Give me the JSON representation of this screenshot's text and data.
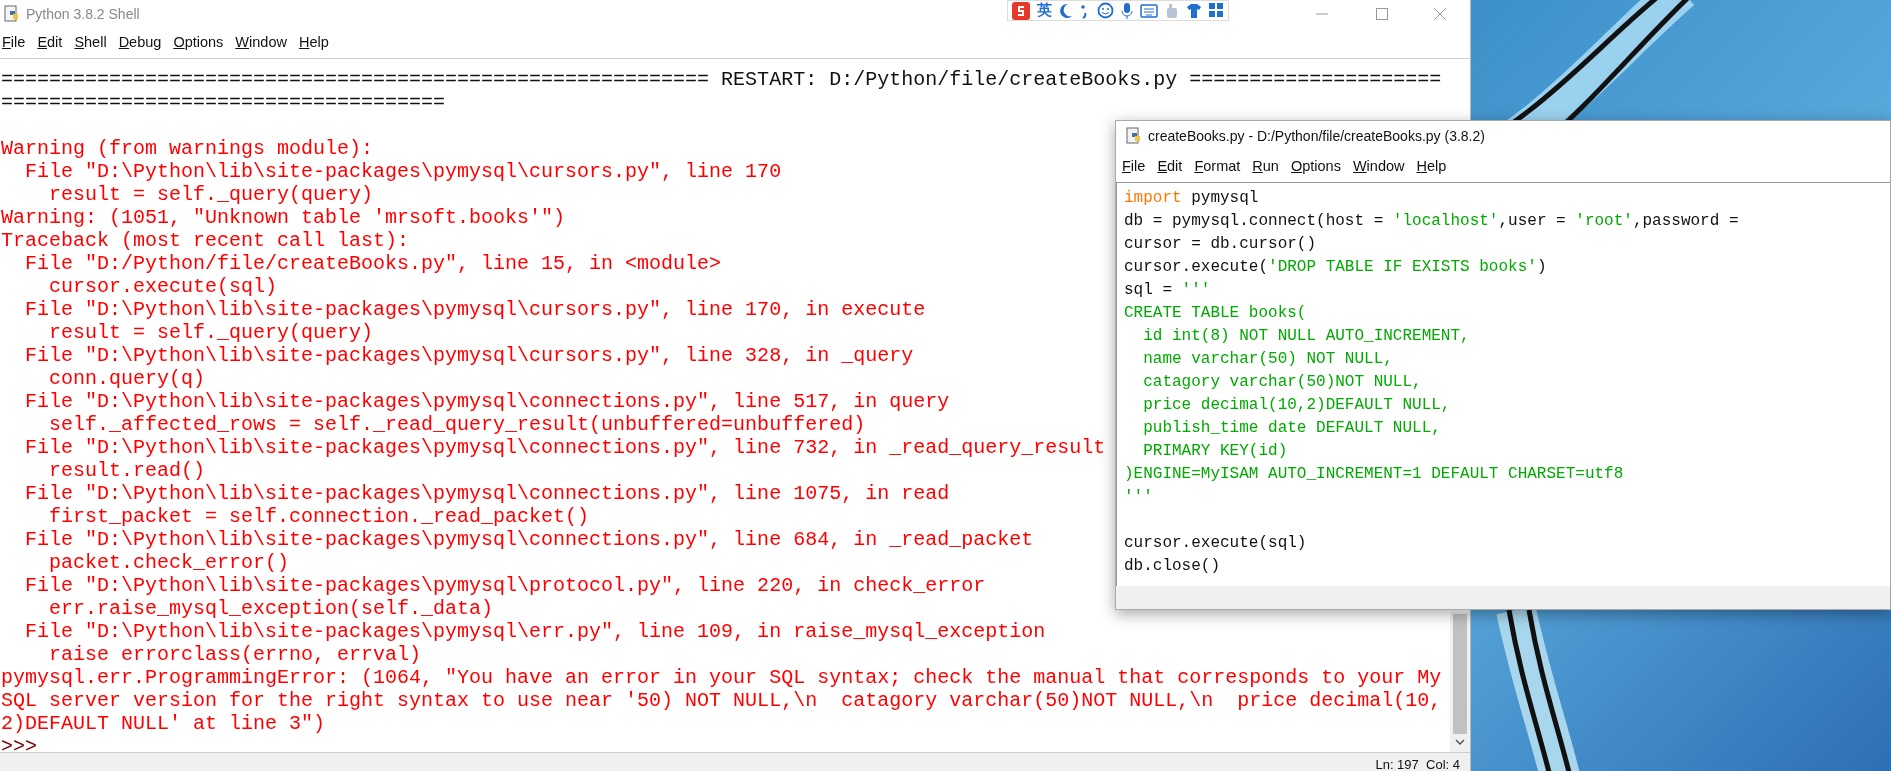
{
  "ime_toolbar": {
    "language": "英"
  },
  "shell": {
    "title": "Python 3.8.2 Shell",
    "menu": [
      "File",
      "Edit",
      "Shell",
      "Debug",
      "Options",
      "Window",
      "Help"
    ],
    "lines": [
      {
        "kind": "restart",
        "text": "=========================================================== RESTART: D:/Python/file/createBooks.py ====================="
      },
      {
        "kind": "restart",
        "text": "====================================="
      },
      {
        "kind": "blank"
      },
      {
        "kind": "error",
        "text": "Warning (from warnings module):"
      },
      {
        "kind": "error",
        "text": "  File \"D:\\Python\\lib\\site-packages\\pymysql\\cursors.py\", line 170"
      },
      {
        "kind": "error",
        "text": "    result = self._query(query)"
      },
      {
        "kind": "error",
        "text": "Warning: (1051, \"Unknown table 'mrsoft.books'\")"
      },
      {
        "kind": "error",
        "text": "Traceback (most recent call last):"
      },
      {
        "kind": "error",
        "text": "  File \"D:/Python/file/createBooks.py\", line 15, in <module>"
      },
      {
        "kind": "error",
        "text": "    cursor.execute(sql)"
      },
      {
        "kind": "error",
        "text": "  File \"D:\\Python\\lib\\site-packages\\pymysql\\cursors.py\", line 170, in execute"
      },
      {
        "kind": "error",
        "text": "    result = self._query(query)"
      },
      {
        "kind": "error",
        "text": "  File \"D:\\Python\\lib\\site-packages\\pymysql\\cursors.py\", line 328, in _query"
      },
      {
        "kind": "error",
        "text": "    conn.query(q)"
      },
      {
        "kind": "error",
        "text": "  File \"D:\\Python\\lib\\site-packages\\pymysql\\connections.py\", line 517, in query"
      },
      {
        "kind": "error",
        "text": "    self._affected_rows = self._read_query_result(unbuffered=unbuffered)"
      },
      {
        "kind": "error",
        "text": "  File \"D:\\Python\\lib\\site-packages\\pymysql\\connections.py\", line 732, in _read_query_result"
      },
      {
        "kind": "error",
        "text": "    result.read()"
      },
      {
        "kind": "error",
        "text": "  File \"D:\\Python\\lib\\site-packages\\pymysql\\connections.py\", line 1075, in read"
      },
      {
        "kind": "error",
        "text": "    first_packet = self.connection._read_packet()"
      },
      {
        "kind": "error",
        "text": "  File \"D:\\Python\\lib\\site-packages\\pymysql\\connections.py\", line 684, in _read_packet"
      },
      {
        "kind": "error",
        "text": "    packet.check_error()"
      },
      {
        "kind": "error",
        "text": "  File \"D:\\Python\\lib\\site-packages\\pymysql\\protocol.py\", line 220, in check_error"
      },
      {
        "kind": "error",
        "text": "    err.raise_mysql_exception(self._data)"
      },
      {
        "kind": "error",
        "text": "  File \"D:\\Python\\lib\\site-packages\\pymysql\\err.py\", line 109, in raise_mysql_exception"
      },
      {
        "kind": "error",
        "text": "    raise errorclass(errno, errval)"
      },
      {
        "kind": "error",
        "text": "pymysql.err.ProgrammingError: (1064, \"You have an error in your SQL syntax; check the manual that corresponds to your My"
      },
      {
        "kind": "error",
        "text": "SQL server version for the right syntax to use near '50) NOT NULL,\\n  catagory varchar(50)NOT NULL,\\n  price decimal(10,"
      },
      {
        "kind": "error",
        "text": "2)DEFAULT NULL' at line 3\")"
      },
      {
        "kind": "prompt",
        "text": ">>>"
      }
    ],
    "status": "Ln: 197  Col: 4"
  },
  "editor": {
    "title": "createBooks.py - D:/Python/file/createBooks.py (3.8.2)",
    "menu": [
      "File",
      "Edit",
      "Format",
      "Run",
      "Options",
      "Window",
      "Help"
    ],
    "lines": [
      {
        "segments": [
          {
            "kind": "keyword",
            "text": "import"
          },
          {
            "kind": "plain",
            "text": " pymysql"
          }
        ]
      },
      {
        "segments": [
          {
            "kind": "plain",
            "text": "db = pymysql.connect(host = "
          },
          {
            "kind": "string",
            "text": "'localhost'"
          },
          {
            "kind": "plain",
            "text": ",user = "
          },
          {
            "kind": "string",
            "text": "'root'"
          },
          {
            "kind": "plain",
            "text": ",password ="
          }
        ]
      },
      {
        "segments": [
          {
            "kind": "plain",
            "text": "cursor = db.cursor()"
          }
        ]
      },
      {
        "segments": [
          {
            "kind": "plain",
            "text": "cursor.execute("
          },
          {
            "kind": "string",
            "text": "'DROP TABLE IF EXISTS books'"
          },
          {
            "kind": "plain",
            "text": ")"
          }
        ]
      },
      {
        "segments": [
          {
            "kind": "plain",
            "text": "sql = "
          },
          {
            "kind": "string",
            "text": "'''"
          }
        ]
      },
      {
        "segments": [
          {
            "kind": "string",
            "text": "CREATE TABLE books("
          }
        ]
      },
      {
        "segments": [
          {
            "kind": "string",
            "text": "  id int(8) NOT NULL AUTO_INCREMENT,"
          }
        ]
      },
      {
        "segments": [
          {
            "kind": "string",
            "text": "  name varchar(50) NOT NULL,"
          }
        ]
      },
      {
        "segments": [
          {
            "kind": "string",
            "text": "  catagory varchar(50)NOT NULL,"
          }
        ]
      },
      {
        "segments": [
          {
            "kind": "string",
            "text": "  price decimal(10,2)DEFAULT NULL,"
          }
        ]
      },
      {
        "segments": [
          {
            "kind": "string",
            "text": "  publish_time date DEFAULT NULL,"
          }
        ]
      },
      {
        "segments": [
          {
            "kind": "string",
            "text": "  PRIMARY KEY(id)"
          }
        ]
      },
      {
        "segments": [
          {
            "kind": "string",
            "text": ")ENGINE=MyISAM AUTO_INCREMENT=1 DEFAULT CHARSET=utf8"
          }
        ]
      },
      {
        "segments": [
          {
            "kind": "string",
            "text": "'''"
          }
        ]
      },
      {
        "kind": "blank"
      },
      {
        "segments": [
          {
            "kind": "plain",
            "text": "cursor.execute(sql)"
          }
        ]
      },
      {
        "segments": [
          {
            "kind": "plain",
            "text": "db.close()"
          }
        ]
      }
    ]
  }
}
